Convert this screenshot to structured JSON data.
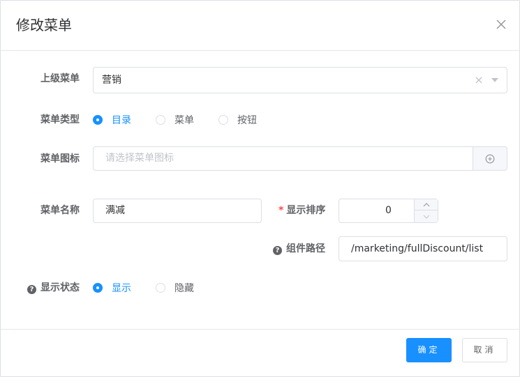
{
  "dialog": {
    "title": "修改菜单",
    "close_icon": "close-icon"
  },
  "form": {
    "parent_menu": {
      "label": "上级菜单",
      "value": "营销",
      "clear_icon": "clear-icon",
      "arrow_icon": "caret-down-icon"
    },
    "menu_type": {
      "label": "菜单类型",
      "options": [
        "目录",
        "菜单",
        "按钮"
      ],
      "selected": "目录"
    },
    "menu_icon": {
      "label": "菜单图标",
      "placeholder": "请选择菜单图标",
      "button_icon": "plus-circle-icon"
    },
    "menu_name": {
      "label": "菜单名称",
      "value": "满减"
    },
    "sort_order": {
      "required_mark": "*",
      "label": "显示排序",
      "value": "0"
    },
    "component_path": {
      "help_icon": "question-circle-icon",
      "label": "组件路径",
      "value": "/marketing/fullDiscount/list"
    },
    "display_status": {
      "help_icon": "question-circle-icon",
      "label": "显示状态",
      "options": [
        "显示",
        "隐藏"
      ],
      "selected": "显示"
    }
  },
  "footer": {
    "confirm_label": "确定",
    "cancel_label": "取消"
  },
  "colors": {
    "primary": "#1890ff",
    "required": "#ff4949",
    "border": "#dcdfe6",
    "text": "#606266"
  }
}
